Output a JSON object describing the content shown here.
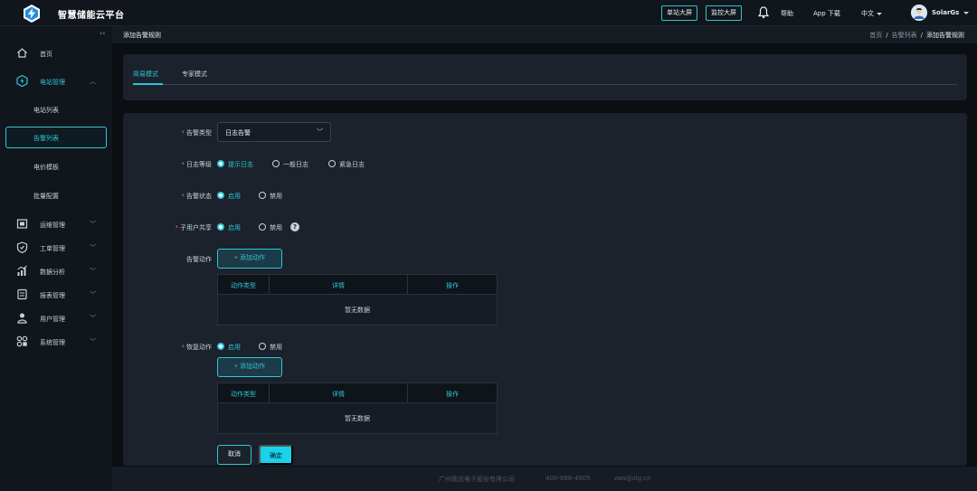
{
  "header": {
    "app_title": "智慧储能云平台",
    "buttons": [
      "单站大屏",
      "监控大屏"
    ],
    "help": "帮助",
    "app_download": "App 下载",
    "language": "中文",
    "username": "SolarGs"
  },
  "sidebar": {
    "collapse": "‹‹",
    "items": [
      {
        "label": "首页",
        "icon": "home-icon"
      },
      {
        "label": "电站管理",
        "icon": "power-station-icon",
        "expanded": true
      },
      {
        "label": "运维管理",
        "icon": "maintenance-icon"
      },
      {
        "label": "工单管理",
        "icon": "work-order-icon"
      },
      {
        "label": "数据分析",
        "icon": "chart-icon"
      },
      {
        "label": "报表管理",
        "icon": "report-icon"
      },
      {
        "label": "用户管理",
        "icon": "user-icon"
      },
      {
        "label": "系统管理",
        "icon": "system-icon"
      }
    ],
    "sub_items": [
      "电站列表",
      "告警列表",
      "电价模板",
      "批量配置"
    ],
    "active_sub": "告警列表"
  },
  "breadcrumb": {
    "page_title": "添加告警规则",
    "trail": [
      "首页",
      "告警列表",
      "添加告警规则"
    ],
    "separator": "/"
  },
  "tabs": {
    "items": [
      "简易模式",
      "专家模式"
    ],
    "active": "简易模式"
  },
  "form": {
    "alarm_type": {
      "label": "告警类型",
      "value": "日志告警"
    },
    "log_level": {
      "label": "日志等级",
      "options": [
        "提示日志",
        "一般日志",
        "紧急日志"
      ],
      "selected": "提示日志"
    },
    "alarm_status": {
      "label": "告警状态",
      "options": [
        "启用",
        "禁用"
      ],
      "selected": "启用"
    },
    "sub_user_share": {
      "label": "子用户共享",
      "options": [
        "启用",
        "禁用"
      ],
      "selected": "启用"
    },
    "alarm_action": {
      "label": "告警动作",
      "add_label": "+ 添加动作"
    },
    "recovery_action": {
      "label": "恢复动作",
      "options": [
        "启用",
        "禁用"
      ],
      "selected": "启用",
      "add_label": "+ 添加动作"
    },
    "table": {
      "columns": [
        "动作类型",
        "详情",
        "操作"
      ],
      "empty": "暂无数据"
    },
    "cancel_label": "取消",
    "confirm_label": "确定"
  },
  "footer": {
    "company": "广州致远电子股份有限公司",
    "phone": "400-888-4005",
    "email": "zws@zlg.cn"
  },
  "colors": {
    "accent": "#2ec6d8",
    "background": "#0b0e12",
    "panel": "#1b222b",
    "required": "#f05454"
  }
}
